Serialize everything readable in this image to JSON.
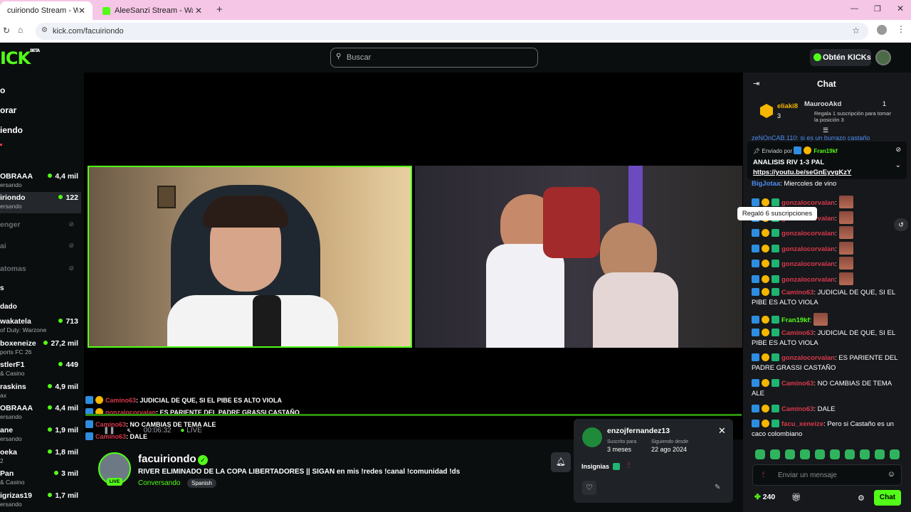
{
  "browser": {
    "tabs": [
      {
        "title": "cuiriondo Stream - Watch Liv"
      },
      {
        "title": "AleeSanzi Stream - Watch Live"
      }
    ],
    "url": "kick.com/facuiriondo"
  },
  "header": {
    "logo": "ICK",
    "logo_beta": "BETA",
    "search_placeholder": "Buscar",
    "kicks_button": "Obtén KICKs"
  },
  "sidebar": {
    "nav": [
      "o",
      "orar",
      "iendo"
    ],
    "channels": [
      {
        "name": "OBRAAA",
        "sub": "ersando",
        "viewers": "4,4 mil"
      },
      {
        "name": "iriondo",
        "sub": "ersando",
        "viewers": "122"
      },
      {
        "name": "enger",
        "sub": "",
        "viewers": ""
      },
      {
        "name": "ai",
        "sub": "",
        "viewers": ""
      },
      {
        "name": "atomas",
        "sub": "",
        "viewers": ""
      }
    ],
    "section": "s",
    "section2": "dado",
    "rec": [
      {
        "name": "wakatela",
        "sub": "of Duty: Warzone",
        "viewers": "713"
      },
      {
        "name": "boxeneize",
        "sub": "ports FC 26",
        "viewers": "27,2 mil"
      },
      {
        "name": "stlerF1",
        "sub": "& Casino",
        "viewers": "449"
      },
      {
        "name": "raskins",
        "sub": "ax",
        "viewers": "4,9 mil"
      },
      {
        "name": "OBRAAA",
        "sub": "ersando",
        "viewers": "4,4 mil"
      },
      {
        "name": "ane",
        "sub": "ersando",
        "viewers": "1,9 mil"
      },
      {
        "name": "oeka",
        "sub": "2",
        "viewers": "1,8 mil"
      },
      {
        "name": "Pan",
        "sub": "& Casino",
        "viewers": "3 mil"
      },
      {
        "name": "igrizas19",
        "sub": "ersando",
        "viewers": "1,7 mil"
      }
    ]
  },
  "overlay_chat": [
    {
      "user": "Camino63",
      "text": ": JUDICIAL DE QUE, SI EL PIBE ES ALTO VIOLA"
    },
    {
      "user": "gonzalocorvalan",
      "text": ": ES PARIENTE DEL PADRE GRASSI CASTAÑO"
    },
    {
      "user": "Camino63",
      "text": ": NO CAMBIAS DE TEMA ALE"
    },
    {
      "user": "Camino63",
      "text": ": DALE"
    }
  ],
  "player": {
    "time": "00:06:32",
    "live": "LIVE"
  },
  "streamer": {
    "name": "facuiriondo",
    "title": "RIVER ELIMINADO DE LA COPA LIBERTADORES || SIGAN en mis !redes !canal !comunidad !ds",
    "category": "Conversando",
    "language": "Spanish",
    "live_badge": "LIVE"
  },
  "notif": {
    "user": "enzojfernandez13",
    "sub_label": "Suscrito para",
    "sub_value": "3 meses",
    "follow_label": "Siguiendo desde",
    "follow_value": "22 ago 2024",
    "badges_label": "Insignias"
  },
  "chat": {
    "title": "Chat",
    "leaderboard": [
      {
        "user": "eliaki8",
        "count": "3"
      },
      {
        "user": "MaurooAkd",
        "count": "1",
        "note": "Regala 1 suscripción para tomar la posición 3"
      }
    ],
    "partial": "zeNOnCAB.110: si es un burrazo castaño",
    "pinned": {
      "sent_by": "Enviado por",
      "sender": "Fran19kf",
      "title": "ANALISIS RIV 1-3 PAL",
      "link": "https://youtu.be/seGnEyvgKzY"
    },
    "tooltip": "Regaló 6 suscripciones",
    "messages": [
      {
        "user": "BigJotaa",
        "text": ": Miercoles de vino",
        "color": "#4e8df0"
      },
      {
        "user": "gonzalocorvalan",
        "text": ":",
        "color": "#d6394c",
        "emote": true
      },
      {
        "user": "gonzalocorvalan",
        "text": ":",
        "color": "#d6394c",
        "emote": true
      },
      {
        "user": "gonzalocorvalan",
        "text": ":",
        "color": "#d6394c",
        "emote": true
      },
      {
        "user": "gonzalocorvalan",
        "text": ":",
        "color": "#d6394c",
        "emote": true
      },
      {
        "user": "gonzalocorvalan",
        "text": ":",
        "color": "#d6394c",
        "emote": true
      },
      {
        "user": "gonzalocorvalan",
        "text": ":",
        "color": "#d6394c",
        "emote": true
      },
      {
        "user": "Camino63",
        "text": ": JUDICIAL DE QUE, SI EL PIBE ES ALTO VIOLA",
        "color": "#d6394c"
      },
      {
        "user": "Fran19kf",
        "text": ":",
        "color": "#53fc18",
        "emote": true
      },
      {
        "user": "Camino63",
        "text": ": JUDICIAL DE QUE, SI EL PIBE ES ALTO VIOLA",
        "color": "#d6394c"
      },
      {
        "user": "gonzalocorvalan",
        "text": ": ES PARIENTE DEL PADRE GRASSI CASTAÑO",
        "color": "#d6394c"
      },
      {
        "user": "Camino63",
        "text": ": NO CAMBIAS DE TEMA ALE",
        "color": "#d6394c"
      },
      {
        "user": "Camino63",
        "text": ": DALE",
        "color": "#d6394c"
      },
      {
        "user": "facu_xeneize",
        "text": ": Pero si Castaño es un caco colombiano",
        "color": "#d6394c"
      }
    ],
    "input_placeholder": "Enviar un mensaje",
    "kicks_balance": "240",
    "send_button": "Chat"
  }
}
